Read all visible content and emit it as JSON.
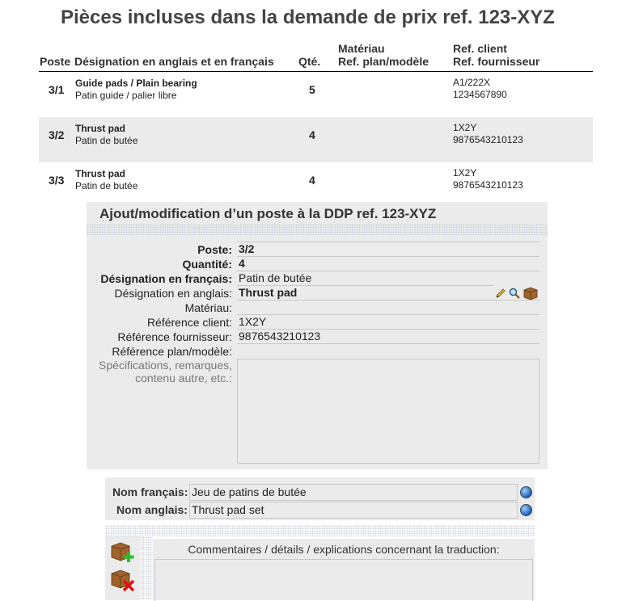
{
  "page_title": "Pièces incluses dans la demande de prix ref. 123-XYZ",
  "table": {
    "headers": {
      "poste": "Poste",
      "designation": "Désignation en anglais et en français",
      "qte": "Qté.",
      "materiau": "Matériau",
      "ref_plan": "Ref. plan/modèle",
      "ref_client": "Ref. client",
      "ref_fournisseur": "Ref. fournisseur"
    },
    "rows": [
      {
        "poste": "3/1",
        "en": "Guide pads / Plain bearing",
        "fr": "Patin guide / palier libre",
        "qty": "5",
        "ref_client": "A1/222X",
        "ref_fournisseur": "1234567890"
      },
      {
        "poste": "3/2",
        "en": "Thrust pad",
        "fr": "Patin de butée",
        "qty": "4",
        "ref_client": "1X2Y",
        "ref_fournisseur": "9876543210123"
      },
      {
        "poste": "3/3",
        "en": "Thrust pad",
        "fr": "Patin de butée",
        "qty": "4",
        "ref_client": "1X2Y",
        "ref_fournisseur": "9876543210123"
      }
    ]
  },
  "form": {
    "title": "Ajout/modification d’un poste à la DDP ref. 123-XYZ",
    "fields": {
      "poste": {
        "label": "Poste:",
        "value": "3/2"
      },
      "quantite": {
        "label": "Quantité:",
        "value": "4"
      },
      "designation_fr": {
        "label": "Désignation en français:",
        "value": "Patin de butée"
      },
      "designation_en": {
        "label": "Désignation en anglais:",
        "value": "Thrust pad"
      },
      "materiau": {
        "label": "Matériau:",
        "value": ""
      },
      "ref_client": {
        "label": "Référence client:",
        "value": "1X2Y"
      },
      "ref_fournisseur": {
        "label": "Référence fournisseur:",
        "value": "9876543210123"
      },
      "ref_plan": {
        "label": "Référence plan/modèle:",
        "value": ""
      },
      "specifications": {
        "label_line1": "Spécifications, remarques,",
        "label_line2": "contenu autre, etc.:",
        "value": ""
      }
    }
  },
  "names": {
    "nom_francais": {
      "label": "Nom français:",
      "value": "Jeu de patins de butée"
    },
    "nom_anglais": {
      "label": "Nom anglais:",
      "value": "Thrust pad set"
    }
  },
  "comments": {
    "title": "Commentaires / détails / explications concernant la traduction:"
  },
  "icons": [
    "pencil-icon",
    "magnifier-icon",
    "box-icon",
    "globe-icon",
    "add-box-icon",
    "remove-box-icon"
  ],
  "colors": {
    "panel_bg": "#ebebeb",
    "alt_row_bg": "#ebebeb",
    "title_text": "#444444"
  }
}
